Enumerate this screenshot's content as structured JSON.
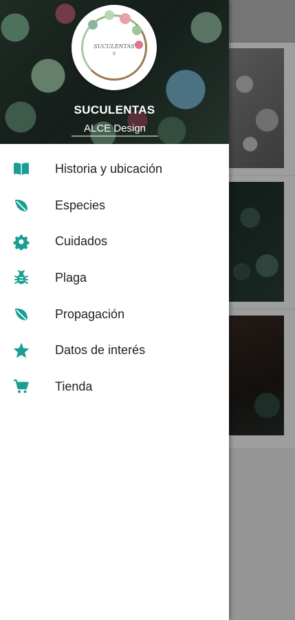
{
  "header": {
    "logo_text": "SUCULENTAS",
    "logo_subtext": "®",
    "title": "SUCULENTAS",
    "subtitle": "ALCE Design"
  },
  "accent_color": "#1a9e93",
  "menu": {
    "items": [
      {
        "label": "Historia y ubicación",
        "icon": "book-icon"
      },
      {
        "label": "Especies",
        "icon": "leaf-icon"
      },
      {
        "label": "Cuidados",
        "icon": "gear-icon"
      },
      {
        "label": "Plaga",
        "icon": "bug-icon"
      },
      {
        "label": "Propagación",
        "icon": "leaf-icon"
      },
      {
        "label": "Datos de interés",
        "icon": "star-icon"
      },
      {
        "label": "Tienda",
        "icon": "cart-icon"
      }
    ]
  }
}
